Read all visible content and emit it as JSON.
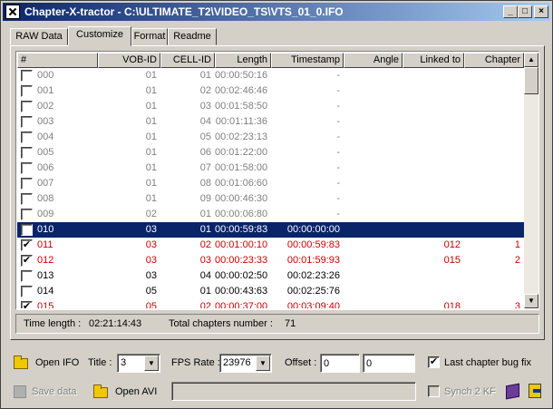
{
  "window": {
    "title": "Chapter-X-tractor - C:\\ULTIMATE_T2\\VIDEO_TS\\VTS_01_0.IFO",
    "min_label": "_",
    "max_label": "□",
    "close_label": "×"
  },
  "tabs": [
    {
      "label": "RAW Data"
    },
    {
      "label": "Customize"
    },
    {
      "label": "Format"
    },
    {
      "label": "Readme"
    }
  ],
  "columns": [
    "#",
    "VOB-ID",
    "CELL-ID",
    "Length",
    "Timestamp",
    "Angle",
    "Linked to",
    "Chapter"
  ],
  "rows": [
    {
      "id": "000",
      "vob": "01",
      "cell": "01",
      "length": "00:00:50:16",
      "ts": "-",
      "angle": "",
      "linked": "",
      "chapter": "",
      "checked": false,
      "style": "gray",
      "check_mark": ""
    },
    {
      "id": "001",
      "vob": "01",
      "cell": "02",
      "length": "00:02:46:46",
      "ts": "-",
      "angle": "",
      "linked": "",
      "chapter": "",
      "checked": false,
      "style": "gray",
      "check_mark": ""
    },
    {
      "id": "002",
      "vob": "01",
      "cell": "03",
      "length": "00:01:58:50",
      "ts": "-",
      "angle": "",
      "linked": "",
      "chapter": "",
      "checked": false,
      "style": "gray",
      "check_mark": ""
    },
    {
      "id": "003",
      "vob": "01",
      "cell": "04",
      "length": "00:01:11:36",
      "ts": "-",
      "angle": "",
      "linked": "",
      "chapter": "",
      "checked": false,
      "style": "gray",
      "check_mark": ""
    },
    {
      "id": "004",
      "vob": "01",
      "cell": "05",
      "length": "00:02:23:13",
      "ts": "-",
      "angle": "",
      "linked": "",
      "chapter": "",
      "checked": false,
      "style": "gray",
      "check_mark": ""
    },
    {
      "id": "005",
      "vob": "01",
      "cell": "06",
      "length": "00:01:22:00",
      "ts": "-",
      "angle": "",
      "linked": "",
      "chapter": "",
      "checked": false,
      "style": "gray",
      "check_mark": ""
    },
    {
      "id": "006",
      "vob": "01",
      "cell": "07",
      "length": "00:01:58:00",
      "ts": "-",
      "angle": "",
      "linked": "",
      "chapter": "",
      "checked": false,
      "style": "gray",
      "check_mark": ""
    },
    {
      "id": "007",
      "vob": "01",
      "cell": "08",
      "length": "00:01:06:60",
      "ts": "-",
      "angle": "",
      "linked": "",
      "chapter": "",
      "checked": false,
      "style": "gray",
      "check_mark": ""
    },
    {
      "id": "008",
      "vob": "01",
      "cell": "09",
      "length": "00:00:46:30",
      "ts": "-",
      "angle": "",
      "linked": "",
      "chapter": "",
      "checked": false,
      "style": "gray",
      "check_mark": ""
    },
    {
      "id": "009",
      "vob": "02",
      "cell": "01",
      "length": "00:00:06:80",
      "ts": "-",
      "angle": "",
      "linked": "",
      "chapter": "",
      "checked": false,
      "style": "gray",
      "check_mark": ""
    },
    {
      "id": "010",
      "vob": "03",
      "cell": "01",
      "length": "00:00:59:83",
      "ts": "00:00:00:00",
      "angle": "",
      "linked": "",
      "chapter": "",
      "checked": false,
      "style": "selected",
      "check_mark": ""
    },
    {
      "id": "011",
      "vob": "03",
      "cell": "02",
      "length": "00:01:00:10",
      "ts": "00:00:59:83",
      "angle": "",
      "linked": "012",
      "chapter": "1",
      "checked": true,
      "style": "red",
      "check_mark": "✔"
    },
    {
      "id": "012",
      "vob": "03",
      "cell": "03",
      "length": "00:00:23:33",
      "ts": "00:01:59:93",
      "angle": "",
      "linked": "015",
      "chapter": "2",
      "checked": true,
      "style": "red",
      "check_mark": "✔"
    },
    {
      "id": "013",
      "vob": "03",
      "cell": "04",
      "length": "00:00:02:50",
      "ts": "00:02:23:26",
      "angle": "",
      "linked": "",
      "chapter": "",
      "checked": false,
      "style": "normal",
      "check_mark": ""
    },
    {
      "id": "014",
      "vob": "05",
      "cell": "01",
      "length": "00:00:43:63",
      "ts": "00:02:25:76",
      "angle": "",
      "linked": "",
      "chapter": "",
      "checked": false,
      "style": "normal",
      "check_mark": ""
    },
    {
      "id": "015",
      "vob": "05",
      "cell": "02",
      "length": "00:00:37:00",
      "ts": "00:03:09:40",
      "angle": "",
      "linked": "018",
      "chapter": "3",
      "checked": true,
      "style": "red",
      "check_mark": "✔"
    }
  ],
  "status": {
    "time_length_label": "Time length :",
    "time_length_value": "02:21:14:43",
    "total_chapters_label": "Total chapters number :",
    "total_chapters_value": "71"
  },
  "controls": {
    "open_ifo_label": "Open IFO",
    "title_label": "Title :",
    "title_value": "3",
    "fps_label": "FPS Rate :",
    "fps_value": "23976",
    "offset_label": "Offset :",
    "offset_value_1": "0",
    "offset_value_2": "0",
    "last_chapter_bug_fix_label": "Last chapter bug fix",
    "last_chapter_check_mark": "✔",
    "save_data_label": "Save data",
    "open_avi_label": "Open AVI",
    "avi_path_value": "",
    "synch_label": "Synch 2 KF",
    "dropdown_arrow": "▼",
    "scroll_up_arrow": "▲",
    "scroll_down_arrow": "▼"
  }
}
